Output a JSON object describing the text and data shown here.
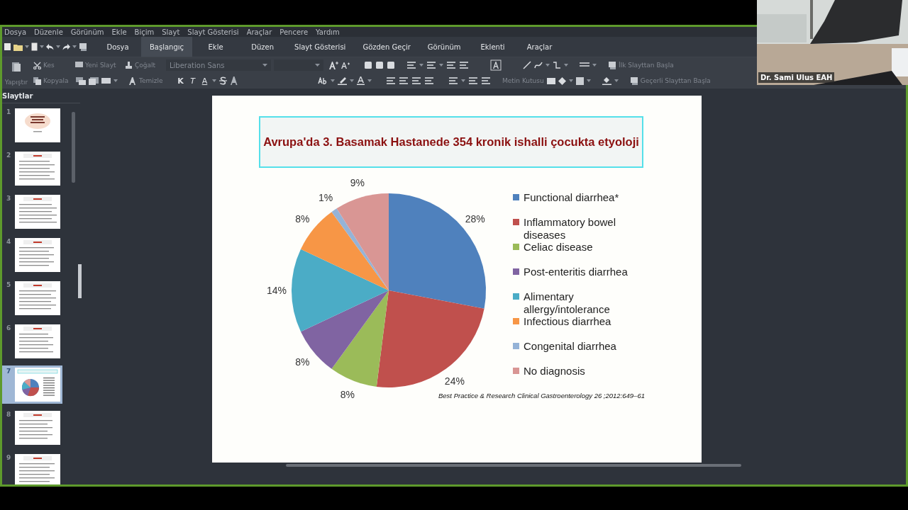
{
  "menu": [
    "Dosya",
    "Düzenle",
    "Görünüm",
    "Ekle",
    "Biçim",
    "Slayt",
    "Slayt Gösterisi",
    "Araçlar",
    "Pencere",
    "Yardım"
  ],
  "tabs": [
    {
      "label": "Dosya",
      "selected": false
    },
    {
      "label": "Başlangıç",
      "selected": true
    },
    {
      "label": "Ekle",
      "selected": false
    },
    {
      "label": "Düzen",
      "selected": false
    },
    {
      "label": "Slayt Gösterisi",
      "selected": false
    },
    {
      "label": "Gözden Geçir",
      "selected": false
    },
    {
      "label": "Görünüm",
      "selected": false
    },
    {
      "label": "Eklenti",
      "selected": false
    },
    {
      "label": "Araçlar",
      "selected": false
    }
  ],
  "toolbar": {
    "cut": {
      "label": "Kes",
      "disabled": true
    },
    "new_slide": {
      "label": "Yeni Slayt",
      "disabled": true
    },
    "duplicate": {
      "label": "Çoğalt",
      "disabled": true
    },
    "font_name": {
      "value": "Liberation Sans",
      "disabled": true
    },
    "paste": {
      "label": "Yapıştır",
      "disabled": true
    },
    "copy": {
      "label": "Kopyala",
      "disabled": true
    },
    "clear": {
      "label": "Temizle",
      "disabled": true
    },
    "bold": {
      "label": "K",
      "disabled": false
    },
    "italic": {
      "label": "T",
      "disabled": false
    },
    "underline": {
      "label": "A",
      "disabled": false
    },
    "text_box": {
      "label": "Metin Kutusu",
      "disabled": true
    },
    "start_first": {
      "label": "İlk Slayttan Başla",
      "disabled": true
    },
    "start_current": {
      "label": "Geçerli Slayttan Başla",
      "disabled": true
    }
  },
  "sidebar": {
    "title": "Slaytlar",
    "slides": [
      {
        "number": "1",
        "selected": false
      },
      {
        "number": "2",
        "selected": false
      },
      {
        "number": "3",
        "selected": false
      },
      {
        "number": "4",
        "selected": false
      },
      {
        "number": "5",
        "selected": false
      },
      {
        "number": "6",
        "selected": false
      },
      {
        "number": "7",
        "selected": true
      },
      {
        "number": "8",
        "selected": false
      },
      {
        "number": "9",
        "selected": false
      }
    ]
  },
  "slide": {
    "title": "Avrupa'da 3. Basamak Hastanede 354 kronik ishalli çocukta etyoloji",
    "chart_data": {
      "type": "pie",
      "categories": [
        "Functional diarrhea*",
        "Inflammatory bowel diseases",
        "Celiac disease",
        "Post-enteritis diarrhea",
        "Alimentary allergy/intolerance",
        "Infectious diarrhea",
        "Congenital diarrhea",
        "No diagnosis"
      ],
      "values": [
        28,
        24,
        8,
        8,
        14,
        8,
        1,
        9
      ],
      "legend": "right",
      "colors": [
        "#4f81bd",
        "#c0504d",
        "#9bbb59",
        "#8064a2",
        "#4bacc6",
        "#f79646",
        "#95b3d7",
        "#d99694"
      ],
      "value_labels": [
        "28%",
        "24%",
        "8%",
        "8%",
        "14%",
        "8%",
        "1%",
        "9%"
      ]
    },
    "citation": "Best Practice & Research Clinical Gastroenterology 26 ;2012:649–61"
  },
  "webcam": {
    "name": "Dr. Sami Ulus EAH"
  }
}
